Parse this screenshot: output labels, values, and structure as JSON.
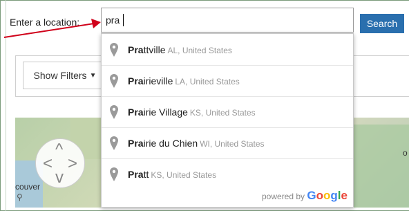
{
  "form": {
    "location_label": "Enter a location:",
    "query": "pra",
    "search_label": "Search"
  },
  "filters": {
    "show_filters_label": "Show Filters"
  },
  "map": {
    "label_left": "couver",
    "label_right": "o"
  },
  "suggestions": {
    "items": [
      {
        "match": "Pra",
        "rest": "ttville",
        "region": "AL, United States"
      },
      {
        "match": "Pra",
        "rest": "irieville",
        "region": "LA, United States"
      },
      {
        "match": "Pra",
        "rest": "irie Village",
        "region": "KS, United States"
      },
      {
        "match": "Pra",
        "rest": "irie du Chien",
        "region": "WI, United States"
      },
      {
        "match": "Pra",
        "rest": "tt",
        "region": "KS, United States"
      }
    ],
    "powered_by": "powered by",
    "google": "Google"
  },
  "colors": {
    "accent": "#2a6fae",
    "annotation_arrow": "#d0021b"
  }
}
